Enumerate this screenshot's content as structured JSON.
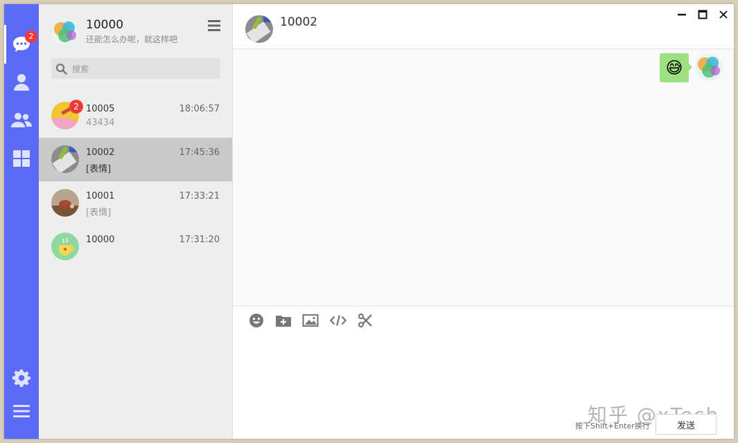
{
  "user": {
    "name": "10000",
    "signature": "还能怎么办呢，就这样吧"
  },
  "nav": {
    "messages_badge": "2"
  },
  "search": {
    "placeholder": "搜索"
  },
  "conversations": [
    {
      "name": "10005",
      "time": "18:06:57",
      "preview": "43434",
      "badge": "2",
      "active": false
    },
    {
      "name": "10002",
      "time": "17:45:36",
      "preview": "[表情]",
      "active": true
    },
    {
      "name": "10001",
      "time": "17:33:21",
      "preview": "[表情]",
      "active": false
    },
    {
      "name": "10000",
      "time": "17:31:20",
      "preview": "",
      "active": false
    }
  ],
  "chat": {
    "title": "10002",
    "messages": [
      {
        "from": "me",
        "content": "😅",
        "type": "emoji"
      }
    ]
  },
  "composer": {
    "hint": "按下Shift+Enter换行",
    "send_label": "发送"
  },
  "watermark": "知乎 @xTech",
  "colors": {
    "rail": "#5b6bf5",
    "badge": "#f03a3a",
    "bubble": "#9de07f",
    "active_row": "#c9c9c9"
  },
  "icons": {
    "rail": [
      "chat-bubble-icon",
      "user-icon",
      "group-icon",
      "apps-grid-icon",
      "gear-icon",
      "hamburger-menu-icon"
    ],
    "toolbar": [
      "emoji-icon",
      "folder-add-icon",
      "image-icon",
      "code-icon",
      "scissors-icon"
    ],
    "window": [
      "minimize-icon",
      "maximize-icon",
      "close-icon"
    ]
  }
}
